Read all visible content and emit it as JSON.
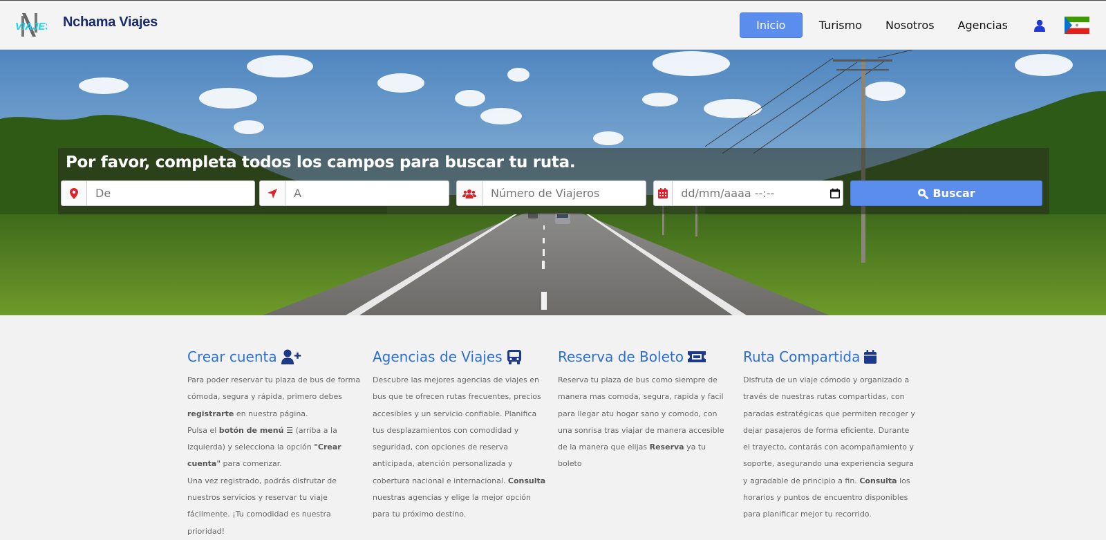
{
  "brand": {
    "logo_text": "VIAJES",
    "name": "Nchama Viajes"
  },
  "nav": {
    "items": [
      {
        "label": "Inicio",
        "active": true
      },
      {
        "label": "Turismo"
      },
      {
        "label": "Nosotros"
      },
      {
        "label": "Agencias"
      }
    ],
    "user_icon": "user-icon",
    "flag_icon": "equatorial-guinea-flag-icon"
  },
  "search": {
    "title": "Por favor, completa todos los campos para buscar tu ruta.",
    "from_placeholder": "De",
    "to_placeholder": "A",
    "travelers_placeholder": "Número de Viajeros",
    "date_placeholder": "dd/mm/aaaa --:--",
    "button_label": "Buscar"
  },
  "colors": {
    "accent": "#5b8def",
    "heading": "#2a6fd6",
    "icon_red": "#e0202a",
    "brand_dark": "#1a2b6d"
  },
  "features": [
    {
      "title": "Crear cuenta",
      "icon": "user-plus-icon",
      "p1a": "Para poder reservar tu plaza de bus de forma cómoda, segura y rápida, primero debes ",
      "p1b": "registrarte",
      "p1c": " en nuestra página.",
      "p2a": "Pulsa el ",
      "p2b": "botón de menú ☰",
      "p2c": " (arriba a la izquierda) y selecciona la opción ",
      "p2d": "\"Crear cuenta\"",
      "p2e": " para comenzar.",
      "p3": "Una vez registrado, podrás disfrutar de nuestros servicios y reservar tu viaje fácilmente. ¡Tu comodidad es nuestra prioridad!"
    },
    {
      "title": "Agencias de Viajes",
      "icon": "bus-icon",
      "p1a": "Descubre las mejores agencias de viajes en bus que te ofrecen rutas frecuentes, precios accesibles y un servicio confiable. Planifica tus desplazamientos con comodidad y seguridad, con opciones de reserva anticipada, atención personalizada y cobertura nacional e internacional. ",
      "p1b": "Consulta",
      "p1c": " nuestras agencias y elige la mejor opción para tu próximo destino."
    },
    {
      "title": "Reserva de Boleto",
      "icon": "ticket-icon",
      "p1a": "Reserva tu plaza de bus como siempre de manera mas comoda, segura, rapida y facil para llegar atu hogar sano y comodo, con una sonrisa tras viajar de manera accesible de la manera que elijas ",
      "p1b": "Reserva",
      "p1c": " ya tu boleto"
    },
    {
      "title": "Ruta Compartida",
      "icon": "calendar-icon",
      "p1a": "Disfruta de un viaje cómodo y organizado a través de nuestras rutas compartidas, con paradas estratégicas que permiten recoger y dejar pasajeros de forma eficiente. Durante el trayecto, contarás con acompañamiento y soporte, asegurando una experiencia segura y agradable de principio a fin. ",
      "p1b": "Consulta",
      "p1c": " los horarios y puntos de encuentro disponibles para planificar mejor tu recorrido."
    }
  ]
}
